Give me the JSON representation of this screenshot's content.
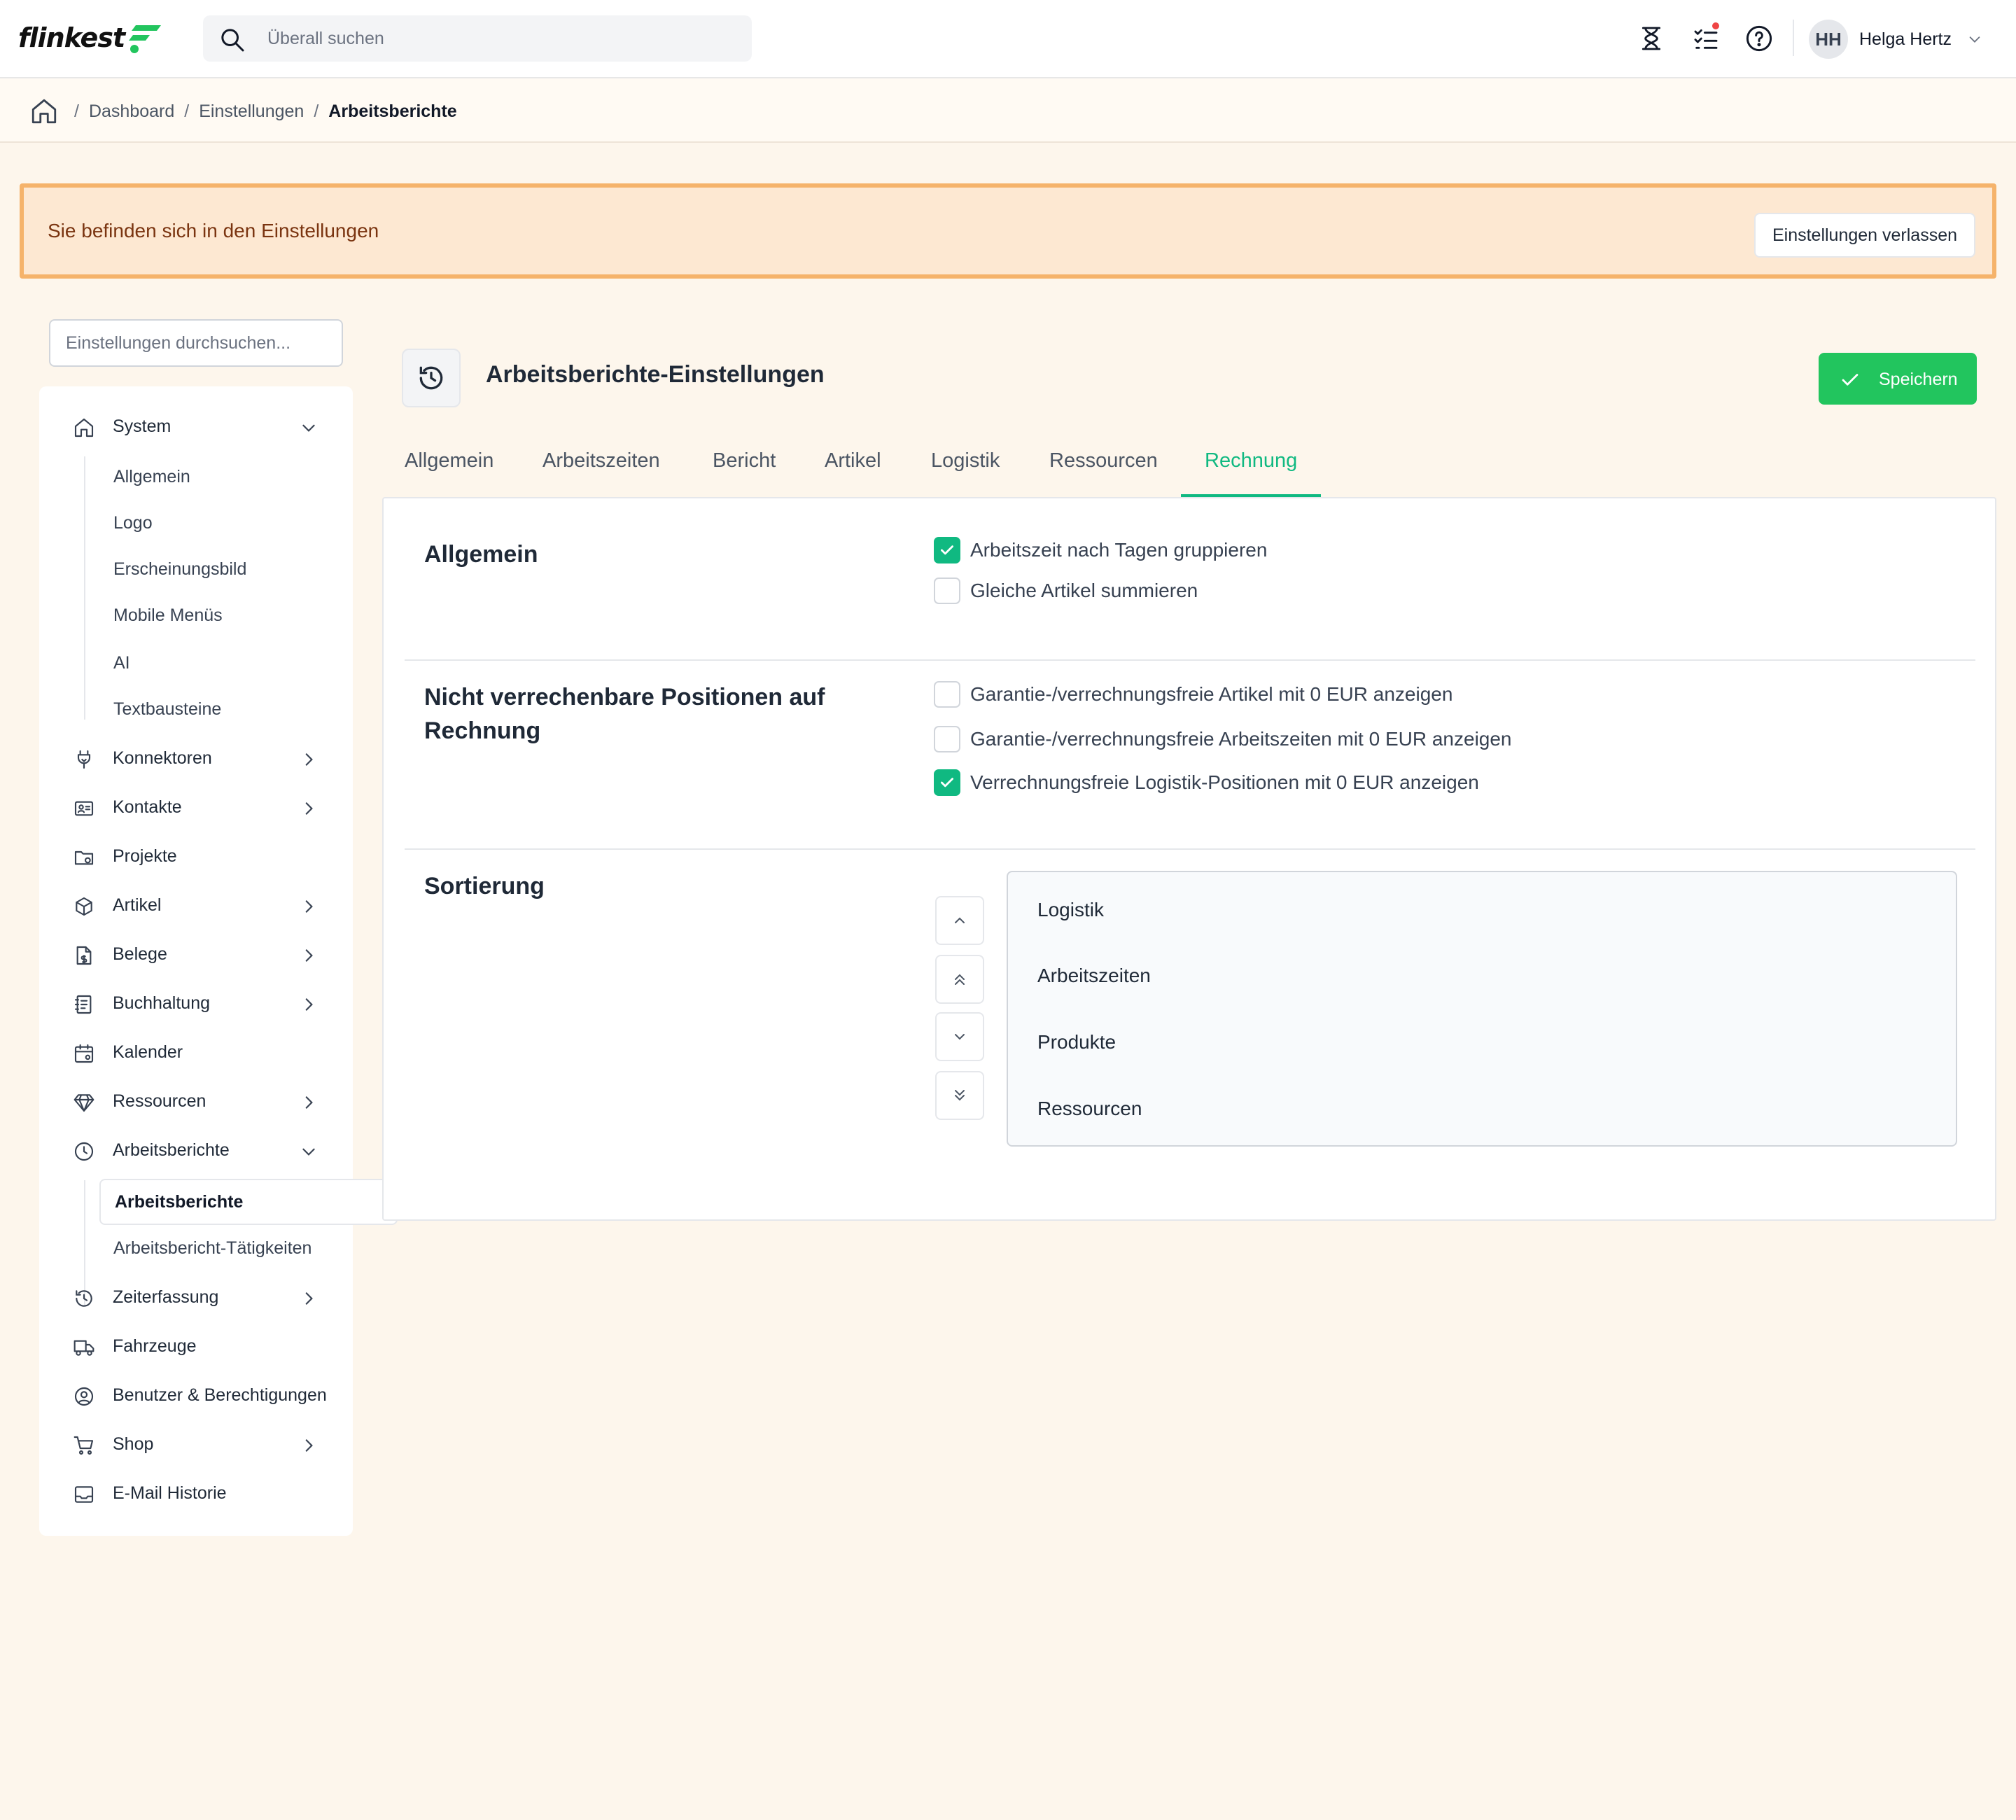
{
  "brand": {
    "name": "flinkest",
    "accent": "#22c55e"
  },
  "search": {
    "placeholder": "Überall suchen"
  },
  "topbar": {
    "icons": [
      "hourglass-icon",
      "tasks-icon",
      "help-icon"
    ],
    "user": {
      "initials": "HH",
      "name": "Helga Hertz"
    }
  },
  "breadcrumb": {
    "home_icon": "home-icon",
    "items": [
      "Dashboard",
      "Einstellungen",
      "Arbeitsberichte"
    ]
  },
  "banner": {
    "text": "Sie befinden sich in den Einstellungen",
    "button": "Einstellungen verlassen",
    "bg": "#fde8d2",
    "border": "#f5b36b"
  },
  "sidebar": {
    "search_placeholder": "Einstellungen durchsuchen...",
    "items": [
      {
        "label": "System",
        "icon": "home-icon",
        "chevron": "down"
      },
      {
        "label": "Konnektoren",
        "icon": "plug-icon",
        "chevron": "right"
      },
      {
        "label": "Kontakte",
        "icon": "contact-card-icon",
        "chevron": "right"
      },
      {
        "label": "Projekte",
        "icon": "folder-gear-icon",
        "chevron": ""
      },
      {
        "label": "Artikel",
        "icon": "box-icon",
        "chevron": "right"
      },
      {
        "label": "Belege",
        "icon": "document-dollar-icon",
        "chevron": "right"
      },
      {
        "label": "Buchhaltung",
        "icon": "ledger-icon",
        "chevron": "right"
      },
      {
        "label": "Kalender",
        "icon": "calendar-gear-icon",
        "chevron": ""
      },
      {
        "label": "Ressourcen",
        "icon": "diamond-icon",
        "chevron": "right"
      },
      {
        "label": "Arbeitsberichte",
        "icon": "clock-icon",
        "chevron": "down"
      },
      {
        "label": "Zeiterfassung",
        "icon": "history-icon",
        "chevron": "right"
      },
      {
        "label": "Fahrzeuge",
        "icon": "truck-icon",
        "chevron": ""
      },
      {
        "label": "Benutzer & Berechtigungen",
        "icon": "user-circle-icon",
        "chevron": ""
      },
      {
        "label": "Shop",
        "icon": "cart-icon",
        "chevron": "right"
      },
      {
        "label": "E-Mail Historie",
        "icon": "inbox-icon",
        "chevron": ""
      }
    ],
    "system_sub": [
      "Allgemein",
      "Logo",
      "Erscheinungsbild",
      "Mobile Menüs",
      "AI",
      "Textbausteine"
    ],
    "arbeitsberichte_sub": [
      "Arbeitsberichte",
      "Arbeitsbericht-Tätigkeiten"
    ],
    "active_sub": "Arbeitsberichte"
  },
  "page": {
    "icon": "clock-icon",
    "title": "Arbeitsberichte-Einstellungen",
    "save": "Speichern"
  },
  "tabs": {
    "items": [
      "Allgemein",
      "Arbeitszeiten",
      "Bericht",
      "Artikel",
      "Logistik",
      "Ressourcen",
      "Rechnung"
    ],
    "active": "Rechnung",
    "active_color": "#10b981"
  },
  "sections": {
    "allgemein": {
      "title": "Allgemein",
      "options": [
        {
          "label": "Arbeitszeit nach Tagen gruppieren",
          "checked": true
        },
        {
          "label": "Gleiche Artikel summieren",
          "checked": false
        }
      ]
    },
    "nicht_verrechenbar": {
      "title_line1": "Nicht verrechenbare Positionen auf",
      "title_line2": "Rechnung",
      "options": [
        {
          "label": "Garantie-/verrechnungsfreie Artikel mit 0 EUR anzeigen",
          "checked": false
        },
        {
          "label": "Garantie-/verrechnungsfreie Arbeitszeiten mit 0 EUR anzeigen",
          "checked": false
        },
        {
          "label": "Verrechnungsfreie Logistik-Positionen mit 0 EUR anzeigen",
          "checked": true
        }
      ]
    },
    "sortierung": {
      "title": "Sortierung",
      "buttons": [
        "chevron-up-icon",
        "chevrons-up-icon",
        "chevron-down-icon",
        "chevrons-down-icon"
      ],
      "items": [
        "Logistik",
        "Arbeitszeiten",
        "Produkte",
        "Ressourcen"
      ]
    }
  }
}
